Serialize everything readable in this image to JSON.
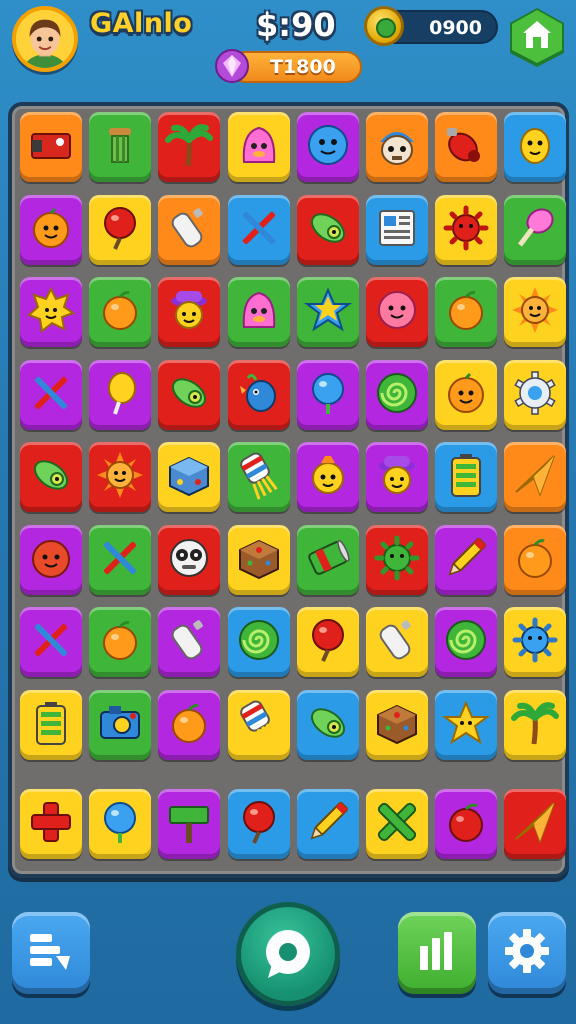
{
  "header": {
    "player_name": "GAlnlo",
    "score": "$:90",
    "coins": "0900",
    "gems": "T1800"
  },
  "colors": {
    "red": "#e0201b",
    "green": "#3fb53a",
    "yellow": "#ffd21f",
    "orange": "#ff8a1a",
    "purple": "#b327e0",
    "blue": "#2b9be8",
    "accent_green_button": "#4cbf3c",
    "accent_blue_button": "#2f90e0"
  },
  "board": {
    "rows": [
      [
        {
          "bg": "orange",
          "icon": "red-block-icon"
        },
        {
          "bg": "green",
          "icon": "pillar-icon"
        },
        {
          "bg": "red",
          "icon": "palm-tree-icon"
        },
        {
          "bg": "yellow",
          "icon": "pink-blob-icon"
        },
        {
          "bg": "purple",
          "icon": "blue-face-icon"
        },
        {
          "bg": "orange",
          "icon": "robot-face-icon"
        },
        {
          "bg": "orange",
          "icon": "red-cannon-icon"
        },
        {
          "bg": "blue",
          "icon": "yellow-bird-icon"
        }
      ],
      [
        {
          "bg": "purple",
          "icon": "orange-face-icon"
        },
        {
          "bg": "yellow",
          "icon": "red-balloon-icon"
        },
        {
          "bg": "orange",
          "icon": "white-bottle-icon"
        },
        {
          "bg": "blue",
          "icon": "pencil-cross-icon"
        },
        {
          "bg": "red",
          "icon": "green-rocket-icon"
        },
        {
          "bg": "blue",
          "icon": "newspaper-icon"
        },
        {
          "bg": "yellow",
          "icon": "red-spiky-ball-icon"
        },
        {
          "bg": "green",
          "icon": "pink-lollipop-icon"
        }
      ],
      [
        {
          "bg": "purple",
          "icon": "yellow-sun-icon"
        },
        {
          "bg": "green",
          "icon": "orange-fruit-icon"
        },
        {
          "bg": "red",
          "icon": "hat-kid-icon"
        },
        {
          "bg": "green",
          "icon": "pink-blob-icon"
        },
        {
          "bg": "green",
          "icon": "blue-star-icon"
        },
        {
          "bg": "red",
          "icon": "pink-face-icon"
        },
        {
          "bg": "green",
          "icon": "orange-fruit-icon"
        },
        {
          "bg": "yellow",
          "icon": "orange-sun-icon"
        }
      ],
      [
        {
          "bg": "purple",
          "icon": "pencil-cross-icon"
        },
        {
          "bg": "purple",
          "icon": "yellow-balloon-icon"
        },
        {
          "bg": "red",
          "icon": "green-rocket-icon"
        },
        {
          "bg": "red",
          "icon": "blue-bird-icon"
        },
        {
          "bg": "purple",
          "icon": "blue-balloon-icon"
        },
        {
          "bg": "purple",
          "icon": "green-spiral-icon"
        },
        {
          "bg": "yellow",
          "icon": "orange-face-icon"
        },
        {
          "bg": "yellow",
          "icon": "white-gear-icon"
        }
      ],
      [
        {
          "bg": "red",
          "icon": "green-rocket-icon"
        },
        {
          "bg": "red",
          "icon": "orange-sun-icon"
        },
        {
          "bg": "yellow",
          "icon": "blue-cube-icon"
        },
        {
          "bg": "green",
          "icon": "striped-brush-icon"
        },
        {
          "bg": "purple",
          "icon": "yellow-face-icon"
        },
        {
          "bg": "purple",
          "icon": "hat-kid-icon"
        },
        {
          "bg": "blue",
          "icon": "battery-icon"
        },
        {
          "bg": "orange",
          "icon": "paper-plane-icon"
        }
      ],
      [
        {
          "bg": "purple",
          "icon": "red-face-icon"
        },
        {
          "bg": "green",
          "icon": "pencil-cross-icon"
        },
        {
          "bg": "red",
          "icon": "white-mask-icon"
        },
        {
          "bg": "yellow",
          "icon": "brown-box-icon"
        },
        {
          "bg": "green",
          "icon": "green-can-icon"
        },
        {
          "bg": "red",
          "icon": "green-spiky-ball-icon"
        },
        {
          "bg": "purple",
          "icon": "pencil-icon"
        },
        {
          "bg": "orange",
          "icon": "orange-fruit-icon"
        }
      ],
      [
        {
          "bg": "purple",
          "icon": "pencil-cross-icon"
        },
        {
          "bg": "green",
          "icon": "orange-fruit-icon"
        },
        {
          "bg": "purple",
          "icon": "white-bottle-icon"
        },
        {
          "bg": "blue",
          "icon": "green-spiral-icon"
        },
        {
          "bg": "yellow",
          "icon": "red-balloon-icon"
        },
        {
          "bg": "yellow",
          "icon": "white-bottle-icon"
        },
        {
          "bg": "purple",
          "icon": "green-spiral-icon"
        },
        {
          "bg": "yellow",
          "icon": "blue-spiky-ball-icon"
        }
      ],
      [
        {
          "bg": "yellow",
          "icon": "battery-icon"
        },
        {
          "bg": "green",
          "icon": "blue-camera-icon"
        },
        {
          "bg": "purple",
          "icon": "orange-fruit-icon"
        },
        {
          "bg": "yellow",
          "icon": "striped-brush-icon"
        },
        {
          "bg": "blue",
          "icon": "green-rocket-icon"
        },
        {
          "bg": "yellow",
          "icon": "brown-box-icon"
        },
        {
          "bg": "blue",
          "icon": "yellow-star-icon"
        },
        {
          "bg": "yellow",
          "icon": "palm-tree-icon"
        }
      ],
      [
        {
          "bg": "yellow",
          "icon": "red-cross-icon"
        },
        {
          "bg": "yellow",
          "icon": "blue-balloon-icon"
        },
        {
          "bg": "purple",
          "icon": "green-sign-icon"
        },
        {
          "bg": "blue",
          "icon": "red-balloon-icon"
        },
        {
          "bg": "blue",
          "icon": "pencil-icon"
        },
        {
          "bg": "yellow",
          "icon": "green-x-icon"
        },
        {
          "bg": "purple",
          "icon": "red-fruit-icon"
        },
        {
          "bg": "red",
          "icon": "paper-plane-icon"
        }
      ]
    ]
  },
  "bottom_bar": {
    "left_button_icon": "menu-list-icon",
    "center_button_icon": "chat-bubble-icon",
    "stats_button_icon": "bar-chart-icon",
    "settings_button_icon": "gear-icon"
  }
}
